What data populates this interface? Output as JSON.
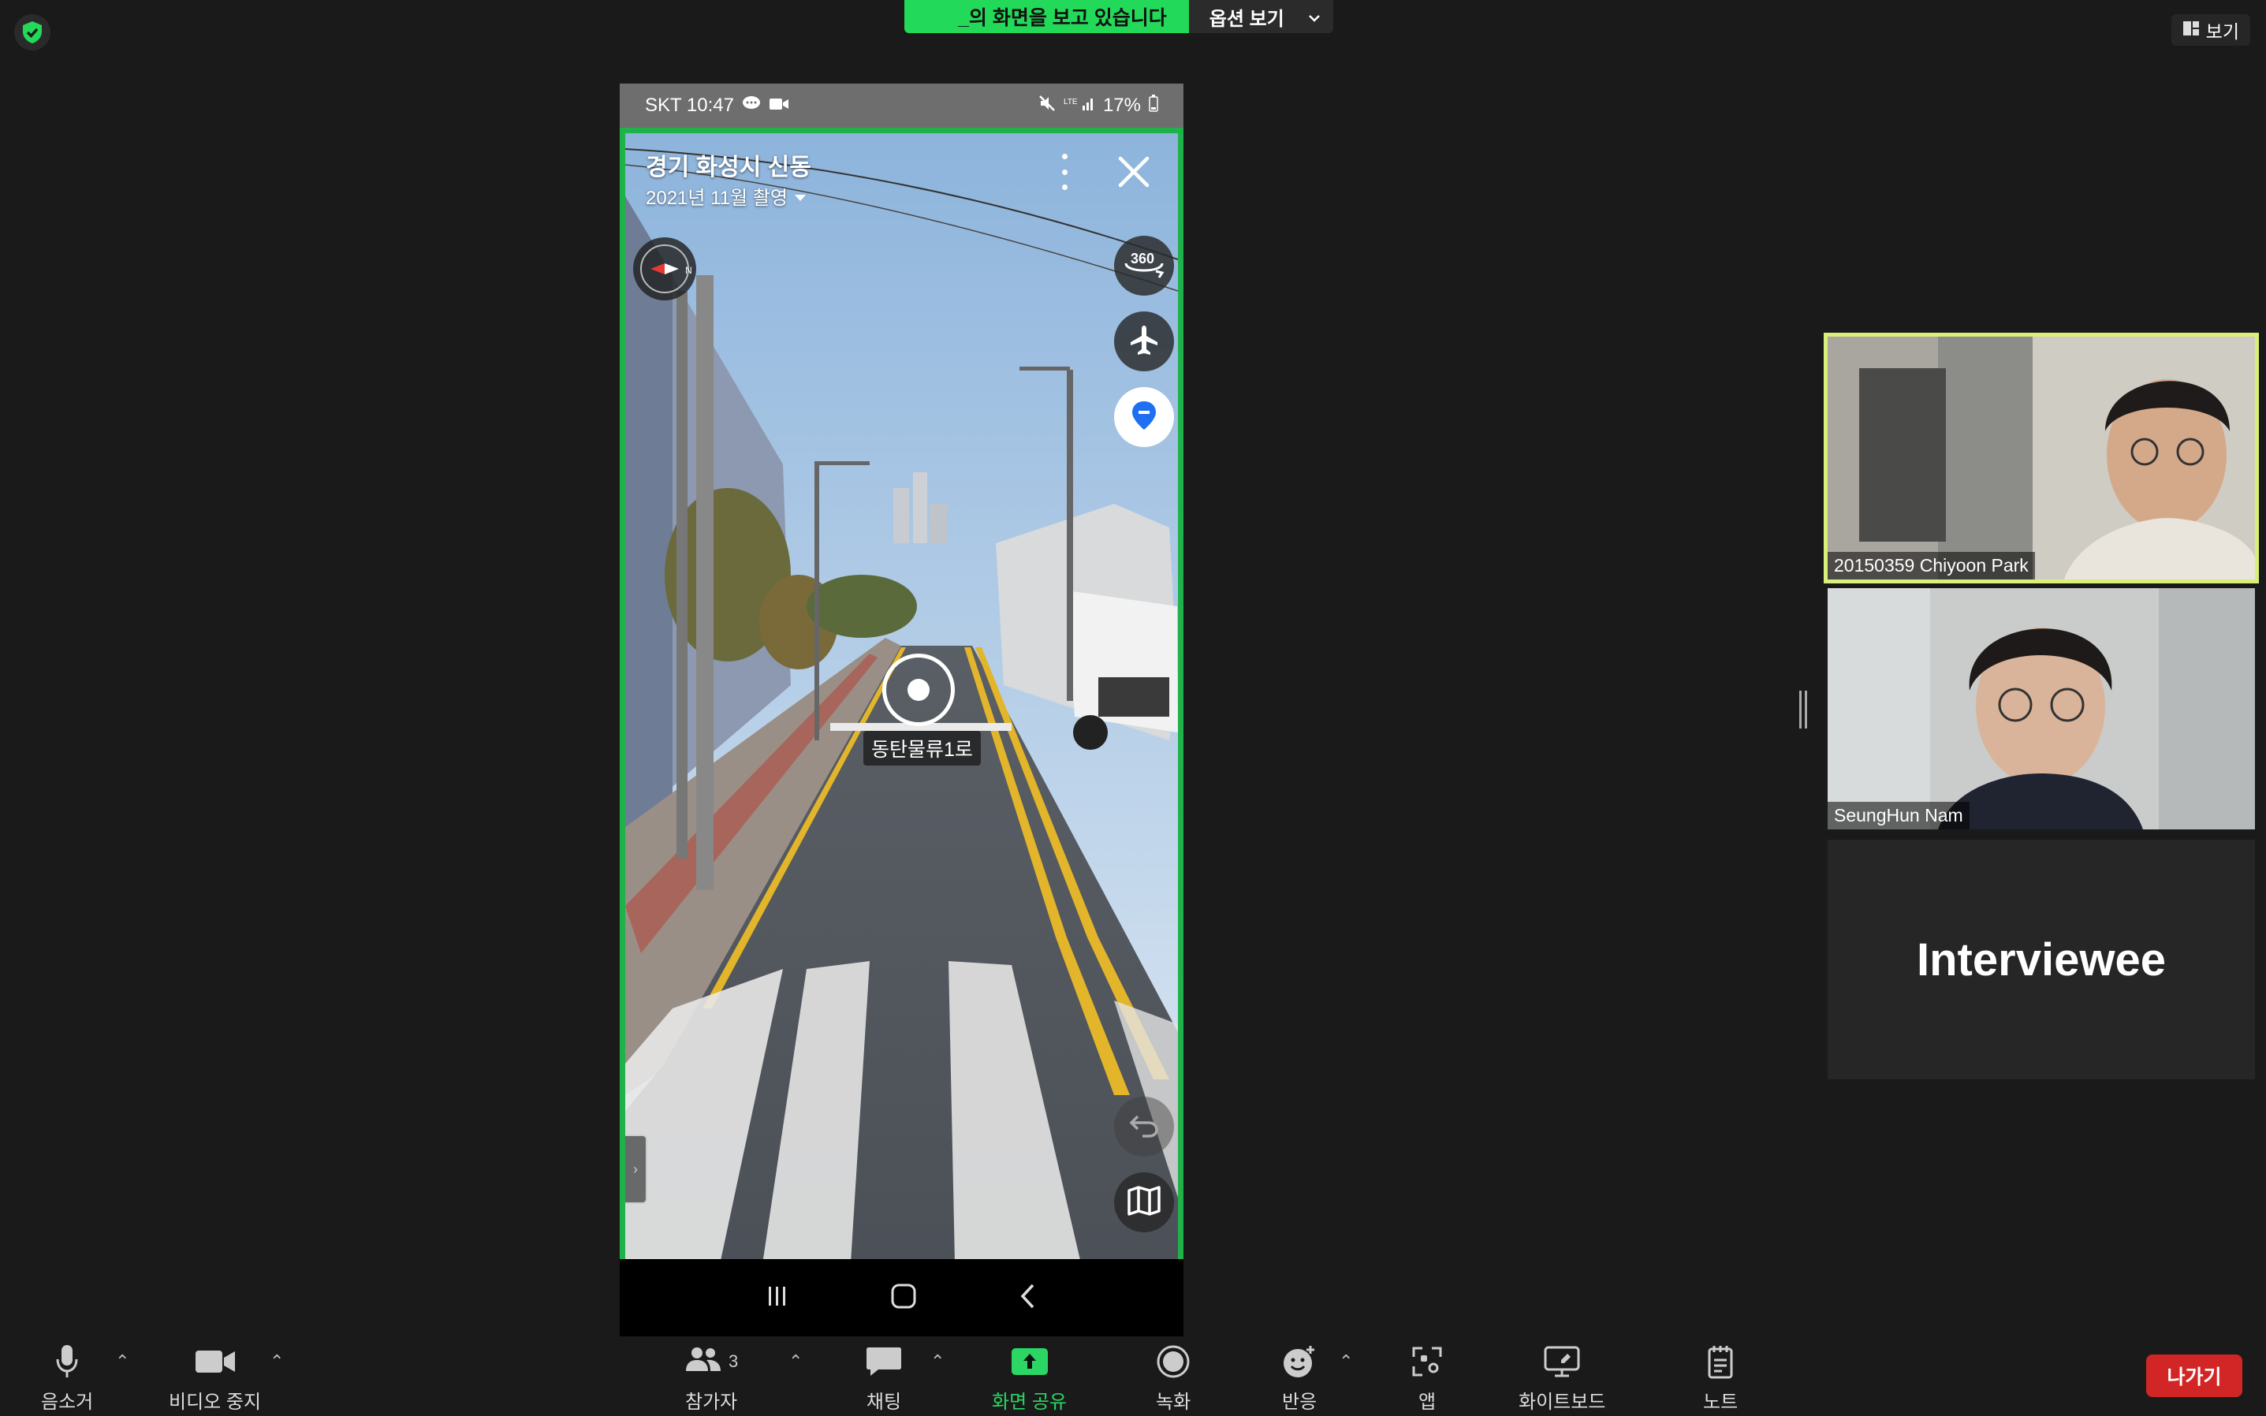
{
  "top": {
    "share_banner_text": "_의 화면을 보고 있습니다",
    "options_label": "옵션 보기",
    "view_label": "보기"
  },
  "phone": {
    "status": {
      "carrier_time": "SKT 10:47",
      "battery": "17%"
    },
    "place_title": "경기 화성시 신동",
    "capture_date": "2021년 11월 촬영",
    "road_label": "동탄물류1로",
    "buttons": {
      "pano": "360"
    }
  },
  "participants": [
    {
      "name": "20150359 Chiyoon Park",
      "active": true
    },
    {
      "name": "SeungHun Nam",
      "active": false
    },
    {
      "name": "Interviewee",
      "active": false
    }
  ],
  "toolbar": {
    "mute": "음소거",
    "stop_video": "비디오 중지",
    "participants": "참가자",
    "participant_count": "3",
    "chat": "채팅",
    "share_screen": "화면 공유",
    "record": "녹화",
    "reactions": "반응",
    "apps": "앱",
    "whiteboard": "화이트보드",
    "notes": "노트",
    "leave": "나가기"
  },
  "colors": {
    "share_green": "#23d959",
    "active_speaker": "#d9ef7b",
    "leave_red": "#d22626",
    "share_border": "#1fb14a"
  }
}
